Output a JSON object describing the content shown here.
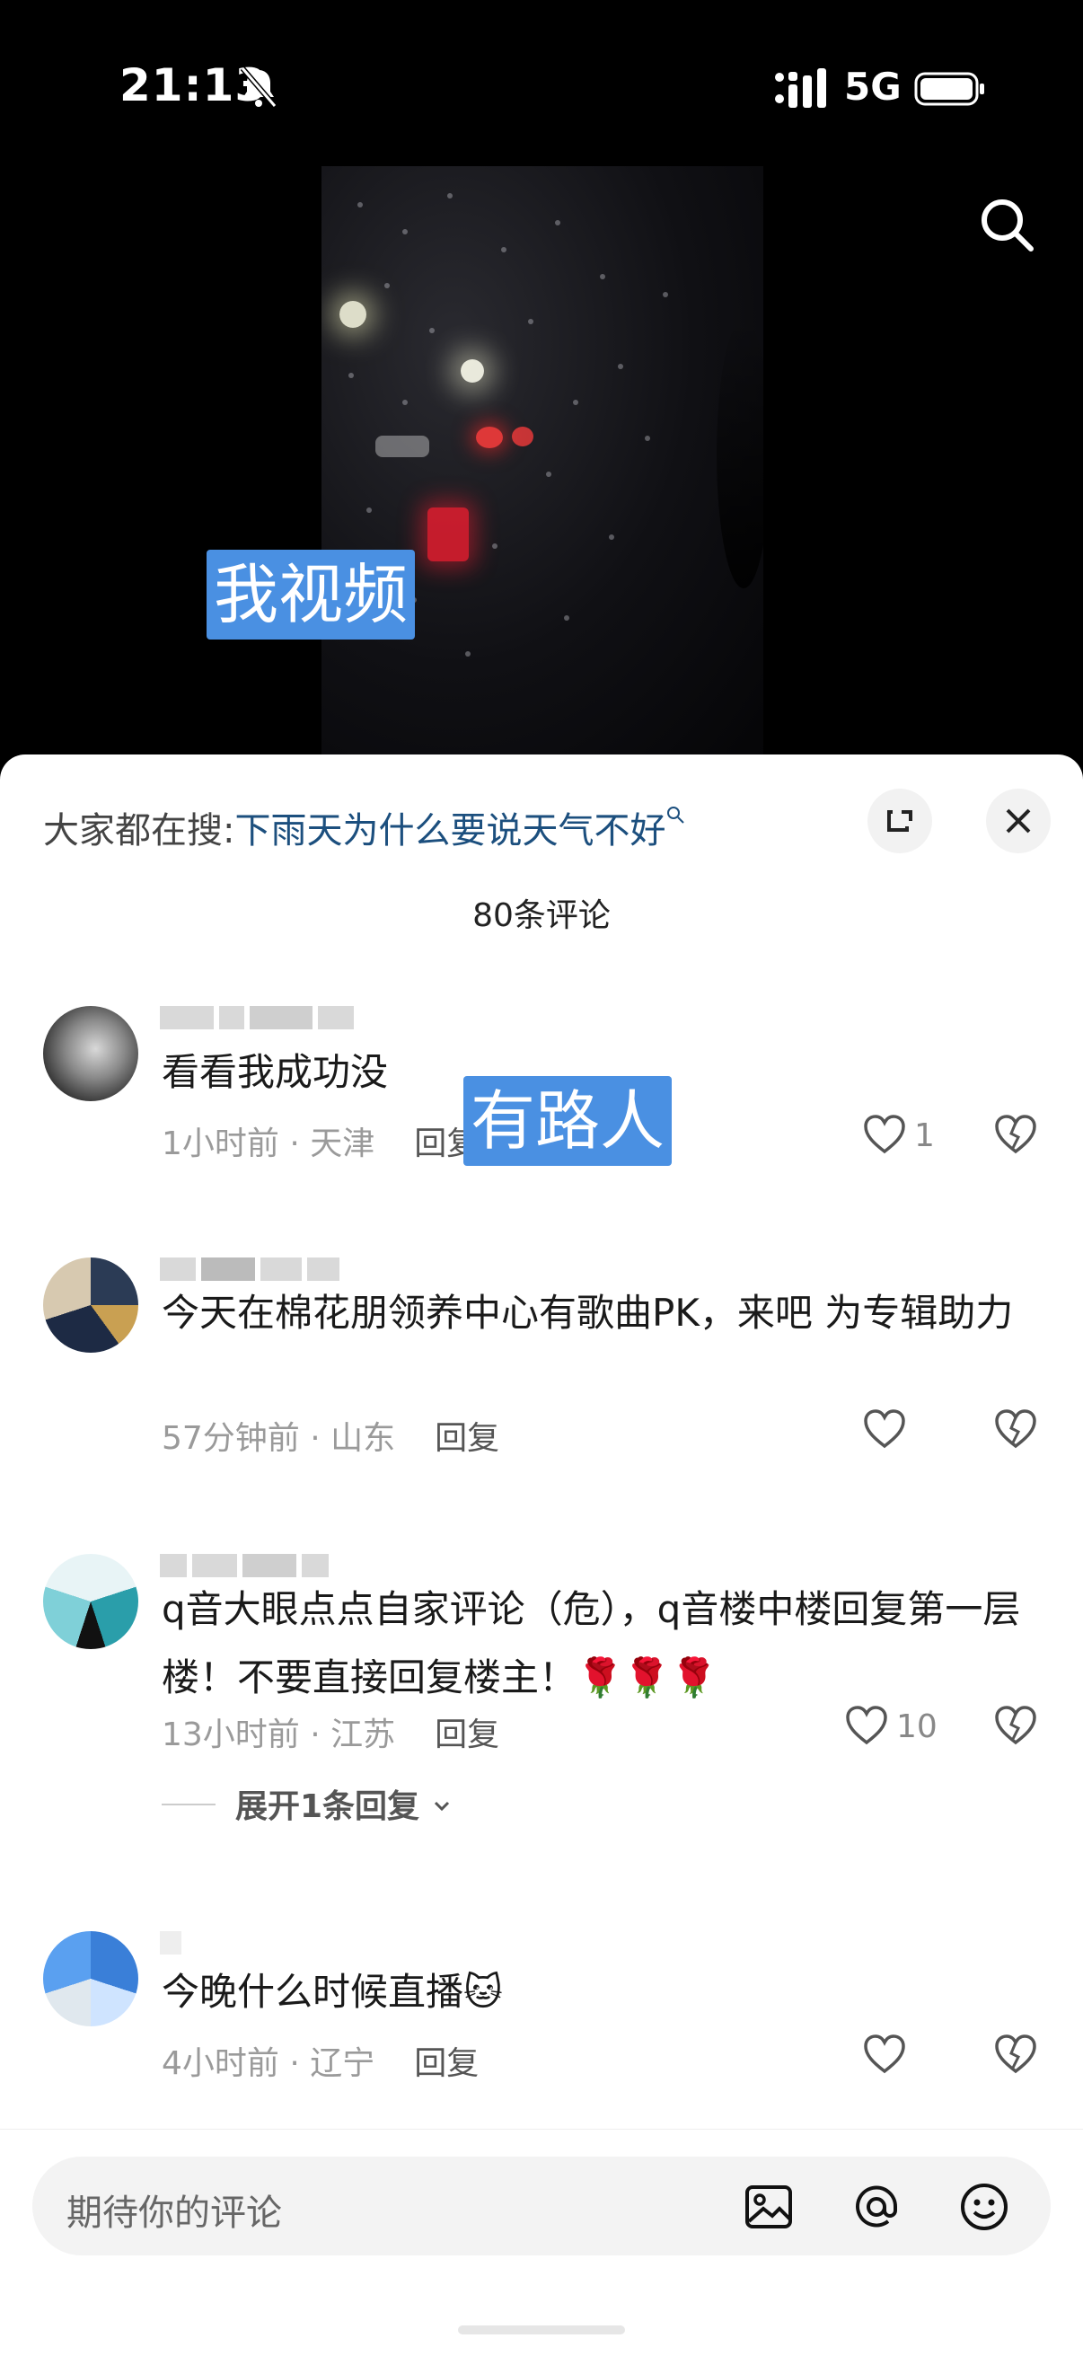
{
  "status_bar": {
    "time": "21:13",
    "network": "5G"
  },
  "video": {
    "overlay_text": "我视频"
  },
  "sheet": {
    "hot_search_prefix": "大家都在搜:",
    "hot_search_term": "下雨天为什么要说天气不好",
    "comment_count": "80条评论",
    "overlay_text": "有路人",
    "comments": [
      {
        "text": "看看我成功没",
        "time_loc": "1小时前 · 天津",
        "reply": "回复",
        "likes": "1"
      },
      {
        "text": "今天在棉花朋领养中心有歌曲PK，来吧 为专辑助力",
        "time_loc": "57分钟前 · 山东",
        "reply": "回复",
        "likes": ""
      },
      {
        "text": "q音大眼点点自家评论（危），q音楼中楼回复第一层楼！不要直接回复楼主！🌹🌹🌹",
        "time_loc": "13小时前 · 江苏",
        "reply": "回复",
        "likes": "10",
        "expand": "展开1条回复"
      },
      {
        "text": "今晚什么时候直播🐱",
        "time_loc": "4小时前 · 辽宁",
        "reply": "回复",
        "likes": ""
      }
    ]
  },
  "input_bar": {
    "placeholder": "期待你的评论"
  },
  "icons": [
    "bell-off-icon",
    "signal-icon",
    "battery-icon",
    "search-icon",
    "expand-icon",
    "close-icon",
    "heart-icon",
    "broken-heart-icon",
    "image-icon",
    "at-icon",
    "emoji-icon",
    "chevron-down-icon"
  ]
}
